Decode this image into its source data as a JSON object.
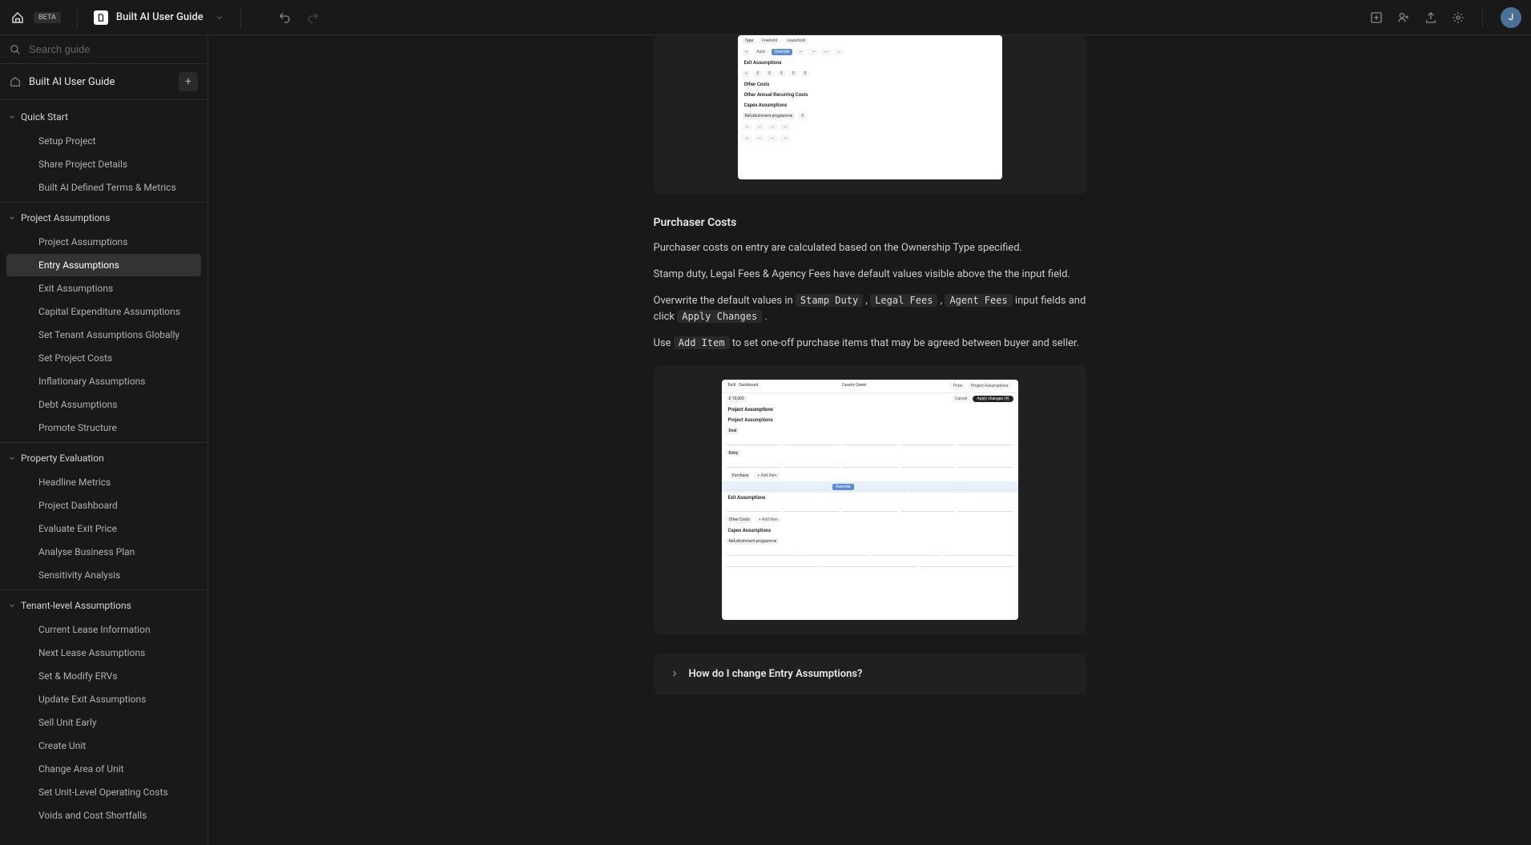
{
  "beta_label": "BETA",
  "doc_title": "Built AI User Guide",
  "search_placeholder": "Search guide",
  "guide_title": "Built AI User Guide",
  "avatar_initial": "J",
  "nav": {
    "sections": [
      {
        "label": "Quick Start",
        "items": [
          "Setup Project",
          "Share Project Details",
          "Built AI Defined Terms & Metrics"
        ]
      },
      {
        "label": "Project Assumptions",
        "items": [
          "Project Assumptions",
          "Entry Assumptions",
          "Exit Assumptions",
          "Capital Expenditure Assumptions",
          "Set Tenant Assumptions Globally",
          "Set Project Costs",
          "Inflationary Assumptions",
          "Debt Assumptions",
          "Promote Structure"
        ],
        "active_index": 1
      },
      {
        "label": "Property Evaluation",
        "items": [
          "Headline Metrics",
          "Project Dashboard",
          "Evaluate Exit Price",
          "Analyse Business Plan",
          "Sensitivity Analysis"
        ]
      },
      {
        "label": "Tenant-level Assumptions",
        "items": [
          "Current Lease Information",
          "Next Lease Assumptions",
          "Set & Modify ERVs",
          "Update Exit Assumptions",
          "Sell Unit Early",
          "Create Unit",
          "Change Area of Unit",
          "Set Unit-Level Operating Costs",
          "Voids and Cost Shortfalls"
        ]
      }
    ]
  },
  "content": {
    "heading1": "Purchaser Costs",
    "p1": "Purchaser costs on entry are calculated based on the Ownership Type specified.",
    "p2": "Stamp duty, Legal Fees & Agency Fees have default values visible above the the input field.",
    "p3_pre": "Overwrite the default values in ",
    "p3_code1": "Stamp Duty",
    "p3_mid1": " , ",
    "p3_code2": "Legal Fees",
    "p3_mid2": " , ",
    "p3_code3": "Agent Fees",
    "p3_mid3": " input fields and click ",
    "p3_code4": "Apply Changes",
    "p3_post": " .",
    "p4_pre": "Use ",
    "p4_code1": "Add Item",
    "p4_post": " to set one-off purchase items that may be agreed between buyer and seller.",
    "accordion_title": "How do I change Entry Assumptions?"
  }
}
